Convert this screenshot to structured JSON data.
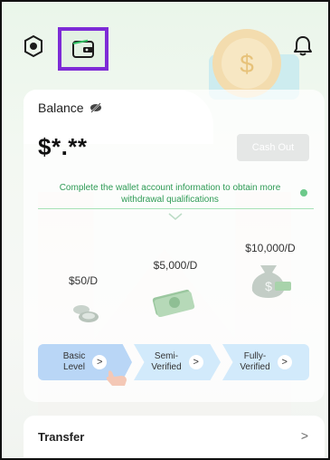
{
  "balance": {
    "label": "Balance",
    "amount": "$*.**",
    "cashout_label": "Cash Out"
  },
  "notice": "Complete the wallet account information to obtain more withdrawal qualifications",
  "levels": [
    {
      "price": "$50/D",
      "label_line1": "Basic",
      "label_line2": "Level"
    },
    {
      "price": "$5,000/D",
      "label_line1": "Semi-",
      "label_line2": "Verified"
    },
    {
      "price": "$10,000/D",
      "label_line1": "Fully-",
      "label_line2": "Verified"
    }
  ],
  "transfer": {
    "label": "Transfer",
    "arrow": ">"
  },
  "icons": {
    "settings": "settings-icon",
    "wallet": "wallet-icon",
    "bell": "bell-icon",
    "eye_hidden": "eye-off-icon"
  },
  "colors": {
    "accent_green": "#2e9b55",
    "highlight_purple": "#7d2bd6"
  }
}
